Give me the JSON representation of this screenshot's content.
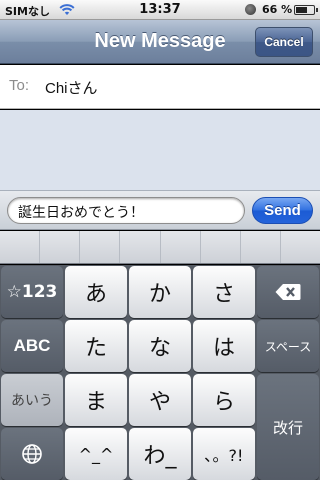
{
  "status": {
    "carrier": "SIMなし",
    "time": "13:37",
    "battery_percent_text": "66 %",
    "battery_level": 0.66
  },
  "nav": {
    "title": "New Message",
    "cancel_label": "Cancel"
  },
  "to_field": {
    "label": "To:",
    "value": "Chiさん"
  },
  "compose": {
    "text": "誕生日おめでとう！",
    "send_label": "Send"
  },
  "keyboard": {
    "mode_123": "☆123",
    "mode_abc": "ABC",
    "mode_kana": "あいう",
    "space": "スペース",
    "return": "改行",
    "row1": [
      "あ",
      "か",
      "さ"
    ],
    "row2": [
      "た",
      "な",
      "は"
    ],
    "row3": [
      "ま",
      "や",
      "ら"
    ],
    "row4": [
      "^_^",
      "わ_",
      "､。?!"
    ]
  },
  "icons": {
    "wifi": "wifi-icon",
    "lock": "rotation-lock-icon",
    "battery": "battery-icon",
    "delete": "delete-key-icon",
    "globe": "globe-icon"
  }
}
